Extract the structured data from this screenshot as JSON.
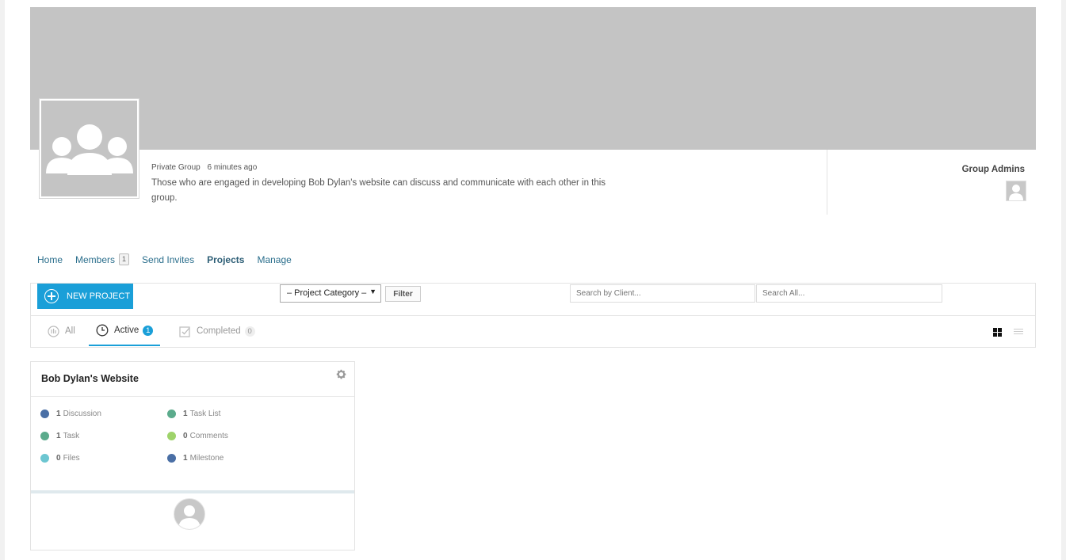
{
  "group": {
    "privacy": "Private Group",
    "time_ago": "6 minutes ago",
    "description": "Those who are engaged in developing Bob Dylan's website can discuss and communicate with each other in this group.",
    "admins_title": "Group Admins"
  },
  "nav": {
    "home": "Home",
    "members": "Members",
    "members_count": "1",
    "send_invites": "Send Invites",
    "projects": "Projects",
    "manage": "Manage"
  },
  "toolbar": {
    "new_project": "NEW PROJECT",
    "category_select": "– Project Category –",
    "filter": "Filter",
    "search_client_placeholder": "Search by Client...",
    "search_all_placeholder": "Search All..."
  },
  "tabs": {
    "all": "All",
    "active": "Active",
    "active_count": "1",
    "completed": "Completed",
    "completed_count": "0"
  },
  "project": {
    "title": "Bob Dylan's Website",
    "stats": {
      "discussion": {
        "count": "1",
        "label": "Discussion"
      },
      "task_list": {
        "count": "1",
        "label": "Task List"
      },
      "task": {
        "count": "1",
        "label": "Task"
      },
      "comments": {
        "count": "0",
        "label": "Comments"
      },
      "files": {
        "count": "0",
        "label": "Files"
      },
      "milestone": {
        "count": "1",
        "label": "Milestone"
      }
    }
  },
  "colors": {
    "accent": "#1a9fd8",
    "nav_link": "#2a6e8c",
    "dot_discussion": "#4a6fa5",
    "dot_task": "#5bab8c",
    "dot_files": "#6cc6d1",
    "dot_task_list": "#5bab8c",
    "dot_comments": "#9ed36a",
    "dot_milestone": "#4a6fa5"
  }
}
